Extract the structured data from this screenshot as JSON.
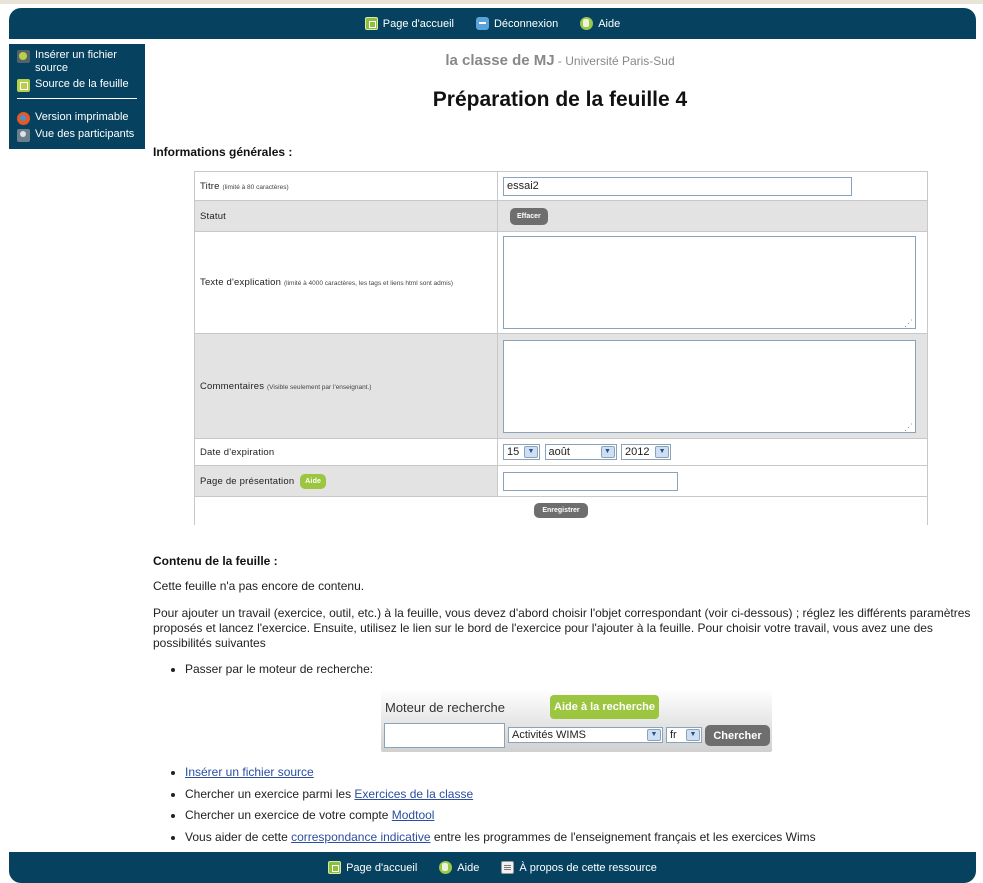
{
  "top_menu": {
    "home": "Page d'accueil",
    "logout": "Déconnexion",
    "help": "Aide"
  },
  "sidebar": {
    "insert_source": "Insérer un fichier source",
    "sheet_source": "Source de la feuille",
    "print_version": "Version imprimable",
    "participants_view": "Vue des participants"
  },
  "site": {
    "class_name": "la classe de MJ",
    "separator": " - ",
    "university": "Université Paris-Sud"
  },
  "page_title": "Préparation de la feuille 4",
  "general_info": {
    "heading": "Informations générales :",
    "title_label": "Titre",
    "title_note": "(limité à 80 caractères)",
    "title_value": "essai2",
    "status_label": "Statut",
    "clear_button": "Effacer",
    "explanation_label": "Texte d'explication",
    "explanation_note": "(limité à 4000 caractères, les tags et liens html sont admis)",
    "comments_label": "Commentaires",
    "comments_note": "(Visible seulement par l'enseignant.)",
    "expiration_label": "Date d'expiration",
    "expiration_day": "15",
    "expiration_month": "août",
    "expiration_year": "2012",
    "presentation_label": "Page de présentation",
    "presentation_help": "Aide",
    "save_button": "Enregistrer"
  },
  "content": {
    "heading": "Contenu de la feuille :",
    "empty_text": "Cette feuille n'a pas encore de contenu.",
    "instructions": "Pour ajouter un travail (exercice, outil, etc.) à la feuille, vous devez d'abord choisir l'objet correspondant (voir ci-dessous) ; réglez les différents paramètres proposés et lancez l'exercice. Ensuite, utilisez le lien sur le bord de l'exercice pour l'ajouter à la feuille. Pour choisir votre travail, vous avez une des possibilités suivantes",
    "option_search": "Passer par le moteur de recherche:",
    "option_insert_link": "Insérer un fichier source",
    "option_class_prefix": "Chercher un exercice parmi les ",
    "option_class_link": "Exercices de la classe",
    "option_modtool_prefix": "Chercher un exercice de votre compte ",
    "option_modtool_link": "Modtool",
    "option_corr_prefix": "Vous aider de cette ",
    "option_corr_link": "correspondance indicative",
    "option_corr_suffix": " entre les programmes de l'enseignement français et les exercices Wims"
  },
  "search": {
    "label": "Moteur de recherche",
    "help_button": "Aide à la recherche",
    "query_value": "",
    "category": "Activités WIMS",
    "language": "fr",
    "submit": "Chercher"
  },
  "bottom_menu": {
    "home": "Page d'accueil",
    "help": "Aide",
    "about": "À propos de cette ressource"
  }
}
